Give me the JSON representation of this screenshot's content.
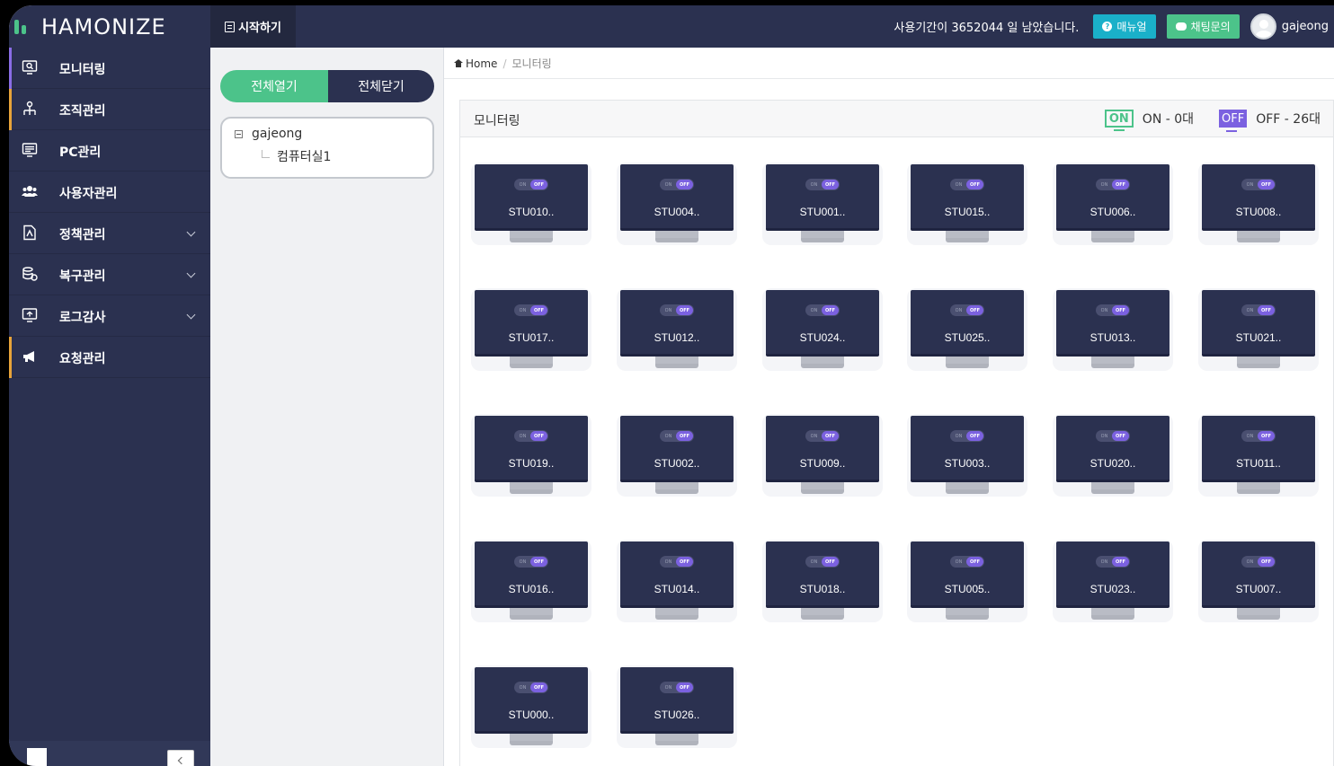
{
  "app": {
    "logo_text": "HAMONIZE",
    "start_tab": "시작하기"
  },
  "header": {
    "remaining_text": "사용기간이 3652044 일 남았습니다.",
    "manual_label": "매뉴얼",
    "chat_label": "채팅문의",
    "username": "gajeong"
  },
  "sidebar": {
    "items": [
      {
        "label": "모니터링",
        "icon": "monitor-search-icon",
        "accent": "#8a6de6",
        "expandable": false
      },
      {
        "label": "조직관리",
        "icon": "org-chart-icon",
        "accent": "#e8a43a",
        "expandable": false
      },
      {
        "label": "PC관리",
        "icon": "pc-list-icon",
        "accent": "",
        "expandable": false
      },
      {
        "label": "사용자관리",
        "icon": "users-icon",
        "accent": "",
        "expandable": false
      },
      {
        "label": "정책관리",
        "icon": "policy-document-icon",
        "accent": "",
        "expandable": true
      },
      {
        "label": "복구관리",
        "icon": "recovery-icon",
        "accent": "",
        "expandable": true
      },
      {
        "label": "로그감사",
        "icon": "log-audit-icon",
        "accent": "",
        "expandable": true
      },
      {
        "label": "요청관리",
        "icon": "megaphone-icon",
        "accent": "#e8a43a",
        "expandable": false
      }
    ]
  },
  "tree": {
    "expand_all": "전체열기",
    "collapse_all": "전체닫기",
    "root": "gajeong",
    "child": "컴퓨터실1"
  },
  "breadcrumb": {
    "home": "Home",
    "current": "모니터링"
  },
  "panel": {
    "title": "모니터링",
    "on_badge": "ON",
    "on_text": "ON - 0대",
    "off_badge": "OFF",
    "off_text": "OFF - 26대"
  },
  "toggle": {
    "on": "ON",
    "off": "OFF"
  },
  "pcs": [
    "STU010..",
    "STU004..",
    "STU001..",
    "STU015..",
    "STU006..",
    "STU008..",
    "STU017..",
    "STU012..",
    "STU024..",
    "STU025..",
    "STU013..",
    "STU021..",
    "STU019..",
    "STU002..",
    "STU009..",
    "STU003..",
    "STU020..",
    "STU011..",
    "STU016..",
    "STU014..",
    "STU018..",
    "STU005..",
    "STU023..",
    "STU007..",
    "STU000..",
    "STU026.."
  ],
  "colors": {
    "navy": "#2b3150",
    "green": "#4cc38a",
    "purple": "#7b61e0",
    "cyan": "#1ab0c9"
  }
}
